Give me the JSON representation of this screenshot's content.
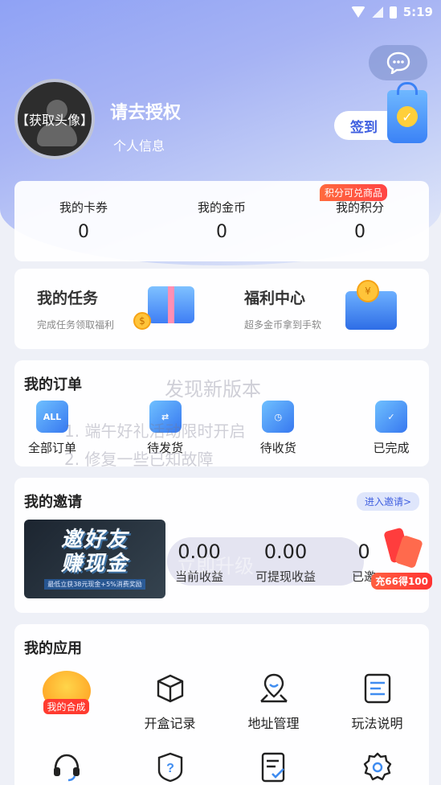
{
  "status_bar": {
    "time": "5:19"
  },
  "profile": {
    "avatar_label": "【获取头像】",
    "name": "请去授权",
    "info_link": "个人信息",
    "checkin_label": "签到"
  },
  "stats": [
    {
      "label": "我的卡券",
      "value": "0"
    },
    {
      "label": "我的金币",
      "value": "0"
    },
    {
      "label": "我的积分",
      "value": "0",
      "badge": "积分可兑商品"
    }
  ],
  "tasks": [
    {
      "title": "我的任务",
      "subtitle": "完成任务领取福利"
    },
    {
      "title": "福利中心",
      "subtitle": "超多金币拿到手软"
    }
  ],
  "orders": {
    "title": "我的订单",
    "items": [
      {
        "label": "全部订单",
        "icon_text": "ALL"
      },
      {
        "label": "待发货",
        "icon_text": ""
      },
      {
        "label": "待收货",
        "icon_text": ""
      },
      {
        "label": "已完成",
        "icon_text": ""
      }
    ]
  },
  "update_overlay": {
    "title": "发现新版本",
    "line1": "1. 端午好礼活动限时开启",
    "line2": "2. 修复一些已知故障",
    "button": "立即升级"
  },
  "invite": {
    "title": "我的邀请",
    "link": "进入邀请>",
    "banner_line1": "邀好友",
    "banner_line2": "赚现金",
    "banner_sub": "最低立获38元现金+5%消费奖励",
    "earnings": [
      {
        "value": "0.00",
        "label": "当前收益"
      },
      {
        "value": "0.00",
        "label": "可提现收益"
      },
      {
        "value": "0",
        "label": "已邀"
      }
    ],
    "recharge_badge": "充66得100"
  },
  "apps": {
    "title": "我的应用",
    "items": [
      {
        "label": "",
        "tag": "我的合成",
        "icon": "synthesis-icon"
      },
      {
        "label": "开盒记录",
        "icon": "box-icon"
      },
      {
        "label": "地址管理",
        "icon": "map-pin-icon"
      },
      {
        "label": "玩法说明",
        "icon": "document-icon"
      },
      {
        "label": "",
        "icon": "headset-icon"
      },
      {
        "label": "",
        "icon": "help-icon"
      },
      {
        "label": "",
        "icon": "checklist-icon"
      },
      {
        "label": "",
        "icon": "settings-icon"
      }
    ]
  },
  "colors": {
    "accent": "#3f5fe0",
    "hero_start": "#8fa2f5",
    "red": "#ff3b30"
  }
}
